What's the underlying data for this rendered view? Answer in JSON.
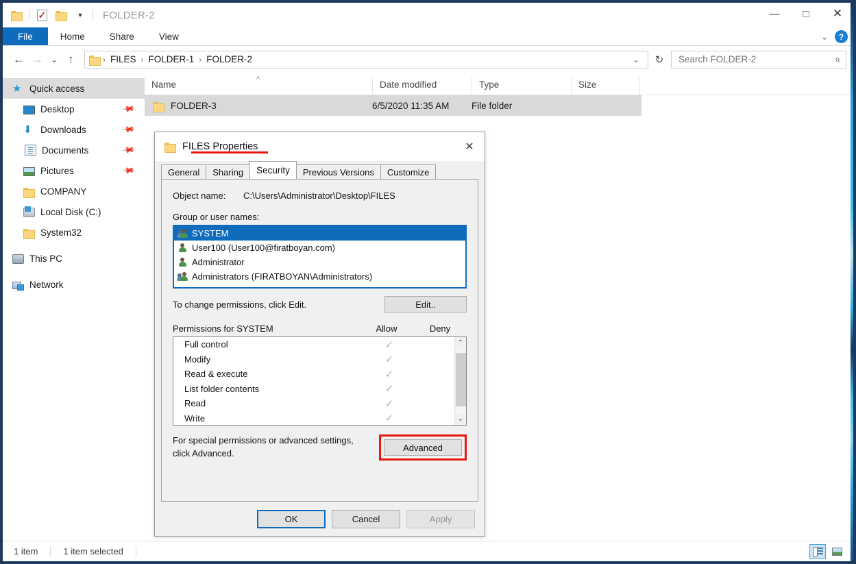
{
  "window": {
    "title": "FOLDER-2",
    "quick_access_toolbar": [
      {
        "name": "folder-icon",
        "label": ""
      },
      {
        "name": "properties-icon",
        "label": ""
      },
      {
        "name": "new-folder-icon",
        "label": ""
      },
      {
        "name": "customize-dropdown-icon",
        "label": "▼"
      }
    ],
    "controls": {
      "minimize": "—",
      "maximize": "□",
      "close": "✕"
    }
  },
  "ribbon": {
    "tabs": [
      {
        "label": "File",
        "active": true
      },
      {
        "label": "Home",
        "active": false
      },
      {
        "label": "Share",
        "active": false
      },
      {
        "label": "View",
        "active": false
      }
    ],
    "collapse_icon": "⌄",
    "help_label": "?"
  },
  "address_bar": {
    "back_icon": "←",
    "forward_icon": "→",
    "recent_icon": "⌄",
    "up_icon": "↑",
    "breadcrumbs": [
      "FILES",
      "FOLDER-1",
      "FOLDER-2"
    ],
    "separator": "›",
    "dropdown_icon": "⌄",
    "refresh_icon": "↻"
  },
  "search": {
    "placeholder": "Search FOLDER-2",
    "value": "",
    "icon": "search-icon"
  },
  "sidebar": {
    "items": [
      {
        "label": "Quick access",
        "icon": "star-icon",
        "selected": true,
        "pinned": false,
        "indent": false
      },
      {
        "label": "Desktop",
        "icon": "desktop-icon",
        "selected": false,
        "pinned": true,
        "indent": true
      },
      {
        "label": "Downloads",
        "icon": "download-icon",
        "selected": false,
        "pinned": true,
        "indent": true
      },
      {
        "label": "Documents",
        "icon": "document-icon",
        "selected": false,
        "pinned": true,
        "indent": true
      },
      {
        "label": "Pictures",
        "icon": "picture-icon",
        "selected": false,
        "pinned": true,
        "indent": true
      },
      {
        "label": "COMPANY",
        "icon": "folder-icon",
        "selected": false,
        "pinned": false,
        "indent": true
      },
      {
        "label": "Local Disk (C:)",
        "icon": "disk-icon",
        "selected": false,
        "pinned": false,
        "indent": true
      },
      {
        "label": "System32",
        "icon": "folder-icon",
        "selected": false,
        "pinned": false,
        "indent": true
      },
      {
        "label": "This PC",
        "icon": "computer-icon",
        "selected": false,
        "pinned": false,
        "indent": false
      },
      {
        "label": "Network",
        "icon": "network-icon",
        "selected": false,
        "pinned": false,
        "indent": false
      }
    ]
  },
  "file_list": {
    "columns": [
      {
        "label": "Name",
        "sorted": "asc",
        "sort_icon": "^"
      },
      {
        "label": "Date modified",
        "sorted": ""
      },
      {
        "label": "Type",
        "sorted": ""
      },
      {
        "label": "Size",
        "sorted": ""
      }
    ],
    "rows": [
      {
        "name": "FOLDER-3",
        "date_modified": "6/5/2020 11:35 AM",
        "type": "File folder",
        "size": "",
        "selected": true,
        "icon": "folder-icon"
      }
    ]
  },
  "status_bar": {
    "item_count": "1 item",
    "selection": "1 item selected",
    "view_buttons": [
      {
        "name": "details-view",
        "selected": true
      },
      {
        "name": "large-icons-view",
        "selected": false
      }
    ]
  },
  "dialog": {
    "title": "FILES Properties",
    "title_underlined": true,
    "close_label": "✕",
    "tabs": [
      {
        "label": "General",
        "active": false
      },
      {
        "label": "Sharing",
        "active": false
      },
      {
        "label": "Security",
        "active": true
      },
      {
        "label": "Previous Versions",
        "active": false
      },
      {
        "label": "Customize",
        "active": false
      }
    ],
    "object_name_label": "Object name:",
    "object_name_value": "C:\\Users\\Administrator\\Desktop\\FILES",
    "group_label": "Group or user names:",
    "groups": [
      {
        "label": "SYSTEM",
        "icon": "group-icon",
        "selected": true
      },
      {
        "label": "User100 (User100@firatboyan.com)",
        "icon": "user-icon",
        "selected": false
      },
      {
        "label": "Administrator",
        "icon": "user-icon",
        "selected": false
      },
      {
        "label": "Administrators (FIRATBOYAN\\Administrators)",
        "icon": "group-icon",
        "selected": false
      }
    ],
    "edit_hint": "To change permissions, click Edit.",
    "edit_button": "Edit..",
    "permissions_label": "Permissions for SYSTEM",
    "allow_header": "Allow",
    "deny_header": "Deny",
    "permissions": [
      {
        "name": "Full control",
        "allow": true,
        "deny": false
      },
      {
        "name": "Modify",
        "allow": true,
        "deny": false
      },
      {
        "name": "Read & execute",
        "allow": true,
        "deny": false
      },
      {
        "name": "List folder contents",
        "allow": true,
        "deny": false
      },
      {
        "name": "Read",
        "allow": true,
        "deny": false
      },
      {
        "name": "Write",
        "allow": true,
        "deny": false
      }
    ],
    "check_glyph": "✓",
    "scroll_up_icon": "⌃",
    "scroll_down_icon": "⌄",
    "advanced_hint_line1": "For special permissions or advanced settings,",
    "advanced_hint_line2": "click Advanced.",
    "advanced_button": "Advanced",
    "advanced_highlighted": true,
    "footer": {
      "ok": "OK",
      "cancel": "Cancel",
      "apply": "Apply",
      "apply_disabled": true
    }
  },
  "annotation_color": "#e8150f"
}
